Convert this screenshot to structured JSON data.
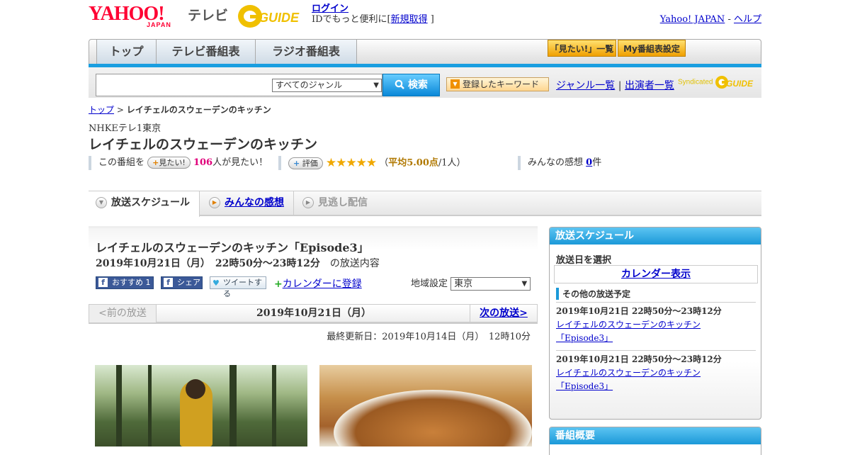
{
  "header": {
    "logo_text": "YAHOO!",
    "logo_sub": "JAPAN",
    "service": "テレビ",
    "gguide_logo": "G-GUIDE",
    "login_link": "ログイン",
    "login_text": "IDでもっと便利に[",
    "signup_link": "新規取得",
    "login_close": " ]",
    "yahoo_link": "Yahoo! JAPAN",
    "sep": " - ",
    "help_link": "ヘルプ"
  },
  "nav": {
    "tabs": [
      "トップ",
      "テレビ番組表",
      "ラジオ番組表"
    ],
    "mitai_list": "「見たい!」一覧",
    "my_settings": "My番組表設定"
  },
  "search": {
    "input_value": "",
    "genre_select": "すべてのジャンル",
    "search_button": "検索",
    "keyword_button": "登録したキーワード",
    "genre_link": "ジャンル一覧",
    "divider": "|",
    "cast_link": "出演者一覧",
    "syndicated": "Syndicated"
  },
  "breadcrumb": {
    "home": "トップ",
    "sep": " > ",
    "current": "レイチェルのスウェーデンのキッチン"
  },
  "program": {
    "channel": "NHKEテレ1東京",
    "title": "レイチェルのスウェーデンのキッチン",
    "mitai_prefix": "この番組を",
    "mitai_button": "見たい!",
    "mitai_count": "106",
    "mitai_suffix": "人が見たい！",
    "rate_button": "評価",
    "stars": "★★★★★",
    "avg_open": "（",
    "avg_text": "平均5.00点",
    "avg_count": "/1人）",
    "impressions_label": "みんなの感想",
    "impressions_count": "0",
    "impressions_unit": "件"
  },
  "tabs": {
    "schedule": "放送スケジュール",
    "impressions": "みんなの感想",
    "catchup": "見逃し配信"
  },
  "episode": {
    "title": "レイチェルのスウェーデンのキッチン「Episode3」",
    "date": "2019年10月21日（月）　22時50分～23時12分",
    "date_suffix": "の放送内容",
    "fb_recommend": "おすすめ 1",
    "fb_share": "シェア",
    "tweet": "ツイートする",
    "calendar_link": "カレンダーに登録",
    "region_label": "地域設定",
    "region_value": "東京"
  },
  "pager": {
    "prev": "<前の放送",
    "current": "2019年10月21日（月）",
    "next": "次の放送>"
  },
  "updated": "最終更新日：2019年10月14日（月）　12時10分",
  "sidebar": {
    "schedule_header": "放送スケジュール",
    "select_date": "放送日を選択",
    "calendar_button": "カレンダー表示",
    "other_header": "その他の放送予定",
    "slots": [
      {
        "time": "2019年10月21日  22時50分～23時12分",
        "title": "レイチェルのスウェーデンのキッチン",
        "episode": "「Episode3」"
      },
      {
        "time": "2019年10月21日  22時50分～23時12分",
        "title": "レイチェルのスウェーデンのキッチン",
        "episode": "「Episode3」"
      }
    ],
    "overview_header": "番組概要"
  },
  "colors": {
    "brand_red": "#ff0033",
    "accent_blue": "#1b99d8",
    "star": "#f0a800",
    "pink": "#e0007a"
  }
}
